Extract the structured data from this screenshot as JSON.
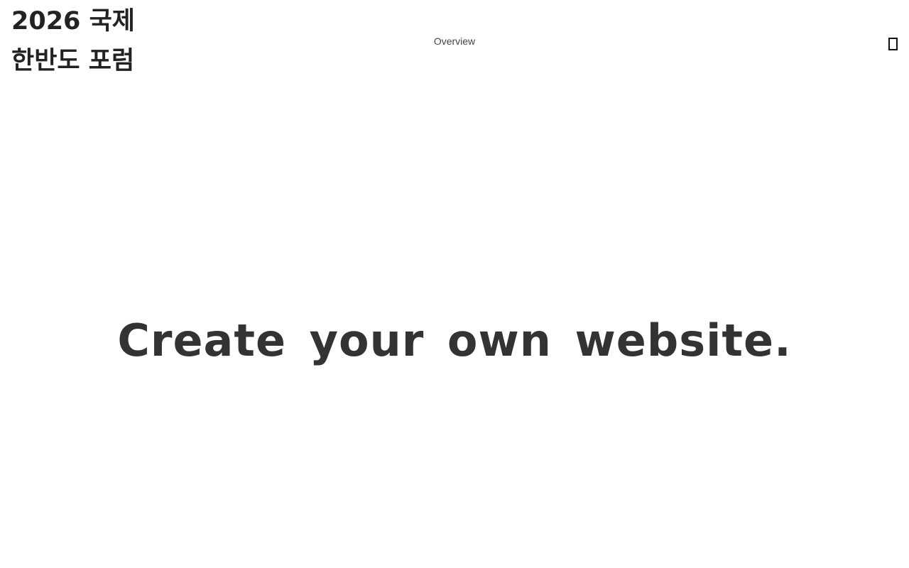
{
  "header": {
    "site_title": "2026 국제 한반도 포럼",
    "nav_overview": "Overview",
    "menu_icon": "menu-icon"
  },
  "hero": {
    "headline": "Create your own website."
  }
}
